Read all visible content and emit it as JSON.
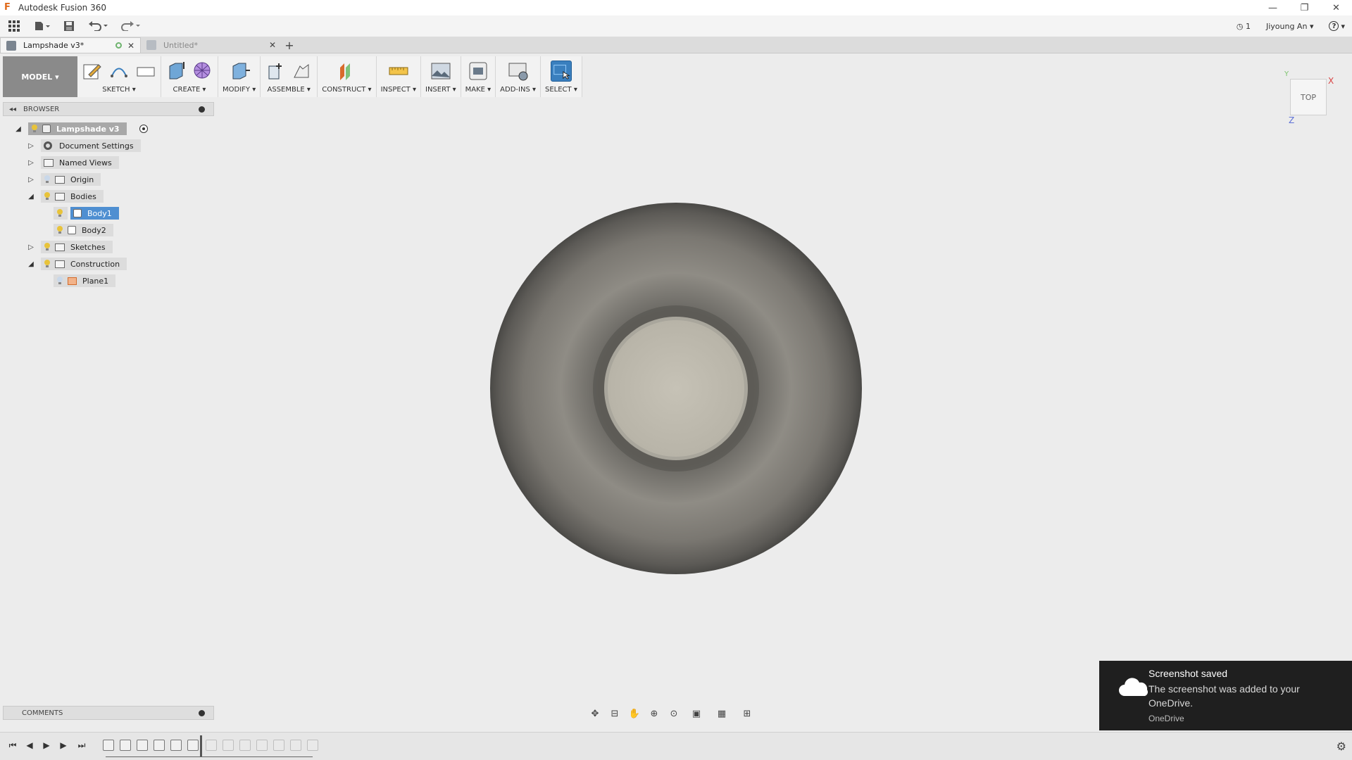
{
  "window": {
    "title": "Autodesk Fusion 360",
    "minimize": "—",
    "restore": "❐",
    "close": "✕"
  },
  "qat": {
    "jobs_count": "1",
    "user": "Jiyoung An",
    "user_arrow": "▾",
    "help": "?"
  },
  "tabs": [
    {
      "label": "Lampshade v3*",
      "close": "✕"
    },
    {
      "label": "Untitled*",
      "close": "✕"
    }
  ],
  "tab_add": "+",
  "toolbar": {
    "workspace": "MODEL ▾",
    "groups": [
      {
        "label": "SKETCH ▾"
      },
      {
        "label": "CREATE ▾"
      },
      {
        "label": "MODIFY ▾"
      },
      {
        "label": "ASSEMBLE ▾"
      },
      {
        "label": "CONSTRUCT ▾"
      },
      {
        "label": "INSPECT ▾"
      },
      {
        "label": "INSERT ▾"
      },
      {
        "label": "MAKE ▾"
      },
      {
        "label": "ADD-INS ▾"
      },
      {
        "label": "SELECT ▾"
      }
    ]
  },
  "browser": {
    "title": "BROWSER",
    "collapse_glyph": "◂◂",
    "root": "Lampshade v3",
    "items": [
      {
        "label": "Document Settings"
      },
      {
        "label": "Named Views"
      },
      {
        "label": "Origin"
      },
      {
        "label": "Bodies"
      },
      {
        "label": "Body1"
      },
      {
        "label": "Body2"
      },
      {
        "label": "Sketches"
      },
      {
        "label": "Construction"
      },
      {
        "label": "Plane1"
      }
    ],
    "expand_collapsed": "▷",
    "expand_open": "◢"
  },
  "viewcube": {
    "face": "TOP",
    "x": "X",
    "y": "Y",
    "z": "Z"
  },
  "comments": {
    "title": "COMMENTS"
  },
  "timeline": {
    "first": "⏮",
    "prev": "◀",
    "play": "▶",
    "next": "▶",
    "last": "⏭",
    "settings": "⚙"
  },
  "toast": {
    "title": "Screenshot saved",
    "body": "The screenshot was added to your OneDrive.",
    "source": "OneDrive"
  },
  "colors": {
    "accent": "#3a7fbe",
    "selection": "#4f8fd1",
    "toast_bg": "#1f1f1f",
    "viewport_bg": "#ececec"
  },
  "icons": {
    "app": "fusion-logo-icon",
    "data_panel": "grid-icon",
    "file": "file-icon",
    "save": "save-icon",
    "undo": "undo-icon",
    "redo": "redo-icon",
    "cloud": "cloud-icon"
  }
}
